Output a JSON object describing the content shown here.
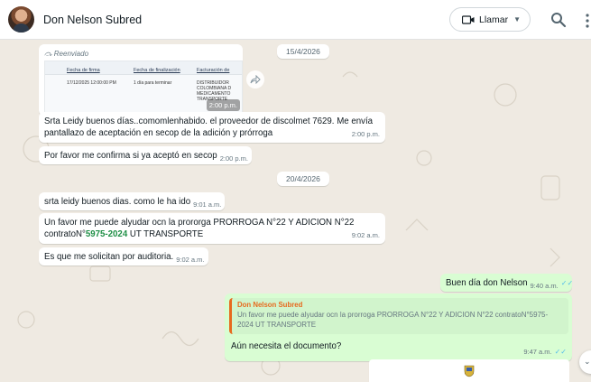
{
  "header": {
    "contact_name": "Don Nelson Subred",
    "call_label": "Llamar",
    "icons": {
      "video": "video-camera-icon",
      "chevron": "chevron-down-icon",
      "search": "search-icon",
      "menu": "more-vertical-icon"
    }
  },
  "chat": {
    "dates": [
      "15/4/2026",
      "20/4/2026"
    ],
    "forwarded": {
      "label": "Reenviado",
      "thumb_columns": [
        "Fecha de firma",
        "Fecha de finalización",
        "Facturación de"
      ],
      "thumb_row": [
        "17/12/2025 12:00:00 PM",
        "1 día para terminar",
        "DISTRIBUIDOR COLOMBIANA D MEDICAMENTO TRANSPORTE"
      ],
      "thumb_time": "2:00 p.m."
    },
    "messages": [
      {
        "id": "m1",
        "direction": "in",
        "text": "Srta Leidy buenos días..comomlenhabido. el proveedor de discolmet 7629. Me envía pantallazo de aceptación en secop de la adición y prórroga",
        "time": "2:00 p.m."
      },
      {
        "id": "m2",
        "direction": "in",
        "text": "Por favor me confirma si ya aceptó en secop",
        "time": "2:00 p.m."
      },
      {
        "id": "m3",
        "direction": "in",
        "text": "srta leidy buenos dias. como le ha ido",
        "time": "9:01 a.m."
      },
      {
        "id": "m4",
        "direction": "in",
        "text_before": "Un favor me puede alyudar ocn la prororga PRORROGA N°22 Y ADICION N°22 contratoN°",
        "highlight": "5975-2024",
        "text_after": " UT TRANSPORTE",
        "time": "9:02 a.m."
      },
      {
        "id": "m5",
        "direction": "in",
        "text": "Es que me solicitan por auditoria.",
        "time": "9:02 a.m."
      },
      {
        "id": "m6",
        "direction": "out",
        "text": "Buen día don Nelson",
        "time": "9:40 a.m."
      },
      {
        "id": "m7",
        "direction": "out",
        "quote_name": "Don Nelson Subred",
        "quote_text": "Un favor me puede alyudar ocn la prorroga PRORROGA N°22 Y ADICION N°22 contratoN°5975-2024 UT TRANSPORTE",
        "text": "Aún necesita el documento?",
        "time": "9:47 a.m."
      }
    ]
  },
  "colors": {
    "chat_bg": "#efeae2",
    "incoming": "#ffffff",
    "outgoing": "#d9fdd3",
    "read_tick": "#53bdeb",
    "quote_accent": "#e76a1e"
  }
}
